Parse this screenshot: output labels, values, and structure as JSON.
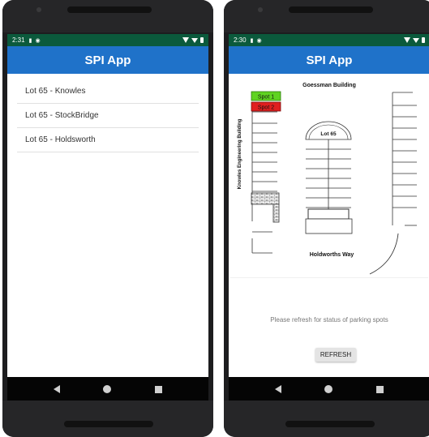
{
  "left_phone": {
    "status": {
      "time": "2:31"
    },
    "app_title": "SPI App",
    "lots": [
      {
        "label": "Lot 65 - Knowles"
      },
      {
        "label": "Lot 65 - StockBridge"
      },
      {
        "label": "Lot 65 - Holdsworth"
      }
    ]
  },
  "right_phone": {
    "status": {
      "time": "2:30"
    },
    "app_title": "SPI App",
    "map": {
      "north_label": "Goessman Building",
      "west_label": "Knowles Engineering Building",
      "south_label": "Holdworths Way",
      "lot_label": "Lot 65",
      "spots": [
        {
          "label": "Spot 1",
          "color": "#5fd321"
        },
        {
          "label": "Spot 2",
          "color": "#e01f1f"
        }
      ]
    },
    "message": "Please refresh for status of parking spots",
    "refresh_label": "REFRESH"
  },
  "colors": {
    "status_bar": "#0b5a3c",
    "app_bar": "#1f72c9"
  },
  "icons": [
    "sim-card-icon",
    "sync-icon",
    "wifi-icon",
    "signal-icon",
    "battery-icon",
    "back-icon",
    "home-icon",
    "recents-icon"
  ]
}
